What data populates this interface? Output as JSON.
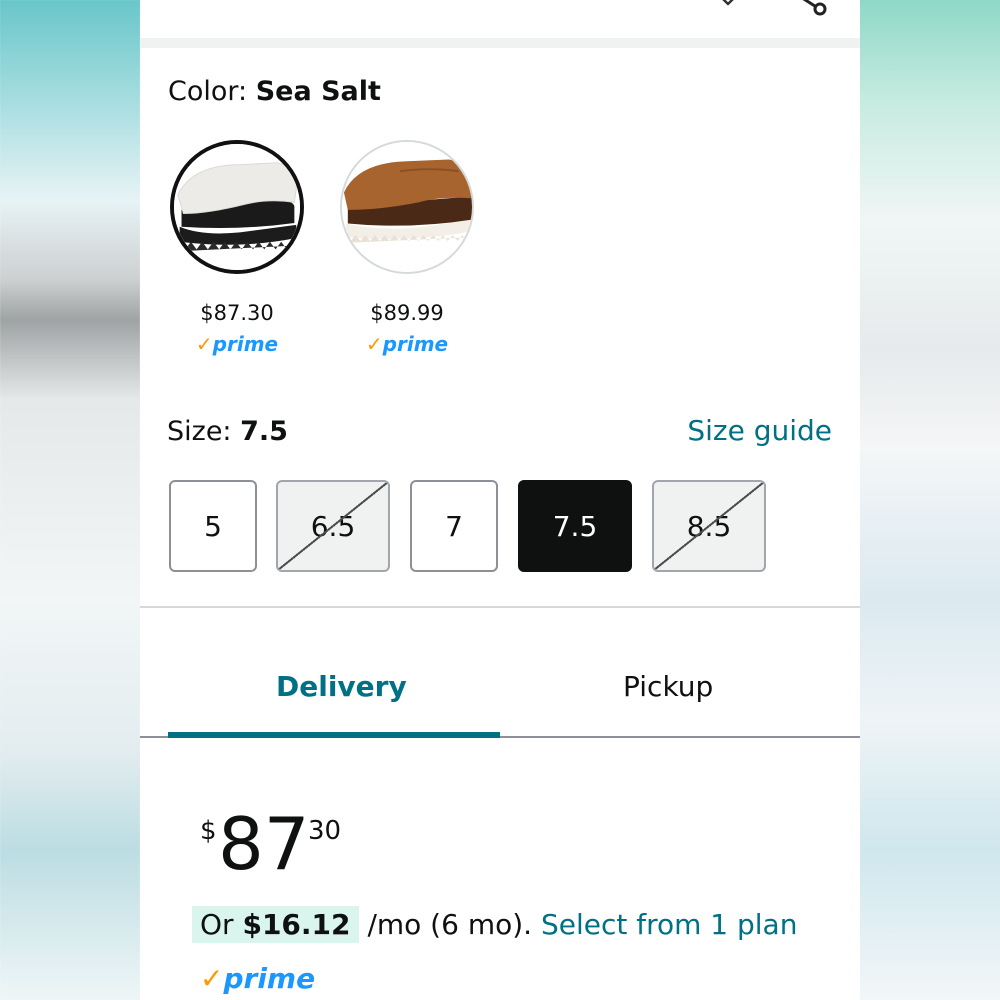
{
  "color": {
    "label": "Color:",
    "value": "Sea Salt",
    "swatches": [
      {
        "name": "Sea Salt",
        "price": "$87.30",
        "prime": "prime",
        "selected": true
      },
      {
        "name": "Brown",
        "price": "$89.99",
        "prime": "prime",
        "selected": false
      }
    ]
  },
  "size": {
    "label": "Size:",
    "value": "7.5",
    "guide_link": "Size guide",
    "options": [
      {
        "label": "5",
        "available": true,
        "selected": false
      },
      {
        "label": "6.5",
        "available": false,
        "selected": false
      },
      {
        "label": "7",
        "available": true,
        "selected": false
      },
      {
        "label": "7.5",
        "available": true,
        "selected": true
      },
      {
        "label": "8.5",
        "available": false,
        "selected": false
      }
    ]
  },
  "tabs": [
    {
      "label": "Delivery",
      "active": true
    },
    {
      "label": "Pickup",
      "active": false
    }
  ],
  "price": {
    "currency": "$",
    "whole": "87",
    "fraction": "30"
  },
  "installment": {
    "prefix": "Or",
    "amount": "$16.12",
    "term": "/mo (6 mo).",
    "link": "Select from 1 plan"
  },
  "prime_badge": "prime",
  "colors": {
    "accent_teal": "#007185",
    "prime_blue": "#1a98ff",
    "prime_check": "#ff9900",
    "selected_size_bg": "#0f1111"
  }
}
